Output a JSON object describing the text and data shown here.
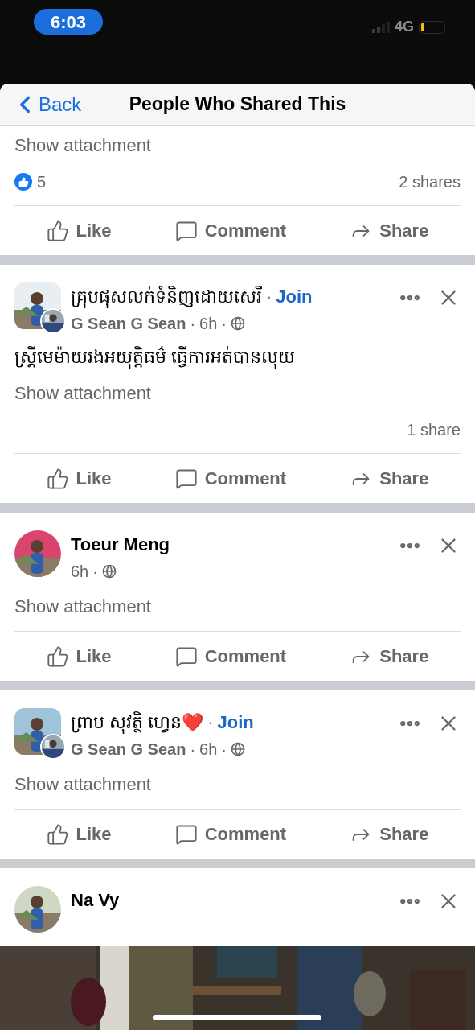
{
  "status_bar": {
    "time": "6:03",
    "network": "4G"
  },
  "header": {
    "back": "Back",
    "title": "People Who Shared This"
  },
  "separator": "·",
  "posts": [
    {
      "kind": "plain",
      "attachment": "Show attachment",
      "likes": "5",
      "shares": "2 shares",
      "actions": [
        "Like",
        "Comment",
        "Share"
      ]
    },
    {
      "kind": "group",
      "group": "គ្រុបផុសលក់ទំនិញដោយសេរី",
      "join": "Join",
      "author": "G Sean G Sean",
      "time": "6h",
      "body": "ស្រ្តីមេម៉ាយរងអយុត្តិធម៌ ធ្វើការអត់បានលុយ",
      "attachment": "Show attachment",
      "shares": "1 share",
      "actions": [
        "Like",
        "Comment",
        "Share"
      ]
    },
    {
      "kind": "person",
      "author": "Toeur Meng",
      "time": "6h",
      "attachment": "Show attachment",
      "actions": [
        "Like",
        "Comment",
        "Share"
      ]
    },
    {
      "kind": "group",
      "group": "ព្រាប សុវត្ថិ ហ្វេន❤️",
      "join": "Join",
      "author": "G Sean G Sean",
      "time": "6h",
      "attachment": "Show attachment",
      "actions": [
        "Like",
        "Comment",
        "Share"
      ]
    },
    {
      "kind": "person",
      "author": "Na Vy"
    }
  ]
}
